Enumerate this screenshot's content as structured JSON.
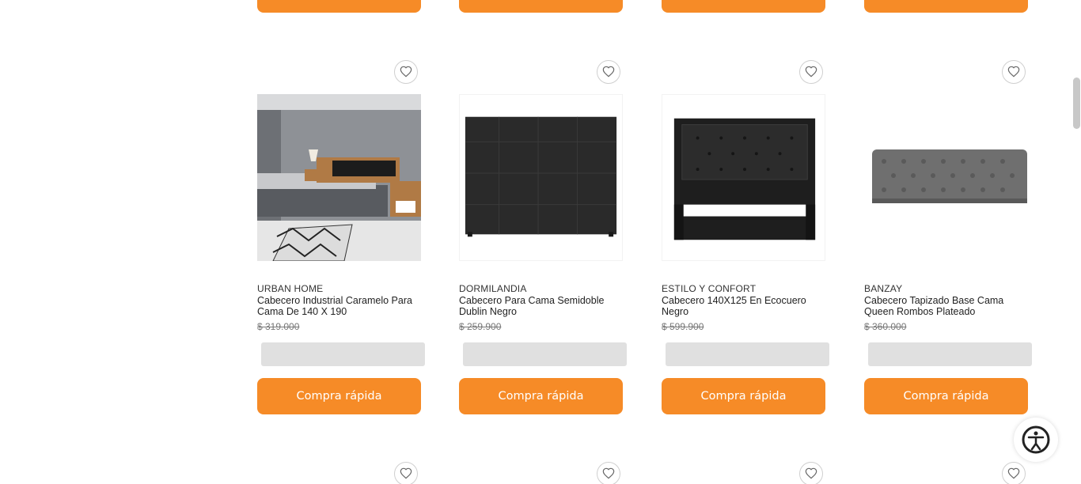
{
  "colors": {
    "accent": "#f68b27",
    "placeholder": "#e0e0e0",
    "price_strike": "#777777"
  },
  "products": [
    {
      "brand": "URBAN HOME",
      "name": "Cabecero Industrial Caramelo Para Cama De 140 X 190",
      "price": "$ 319.000",
      "button_label": "Compra rápida",
      "favorite_icon": "heart-icon"
    },
    {
      "brand": "DORMILANDIA",
      "name": "Cabecero Para Cama Semidoble Dublin Negro",
      "price": "$ 259.900",
      "button_label": "Compra rápida",
      "favorite_icon": "heart-icon"
    },
    {
      "brand": "ESTILO Y CONFORT",
      "name": "Cabecero 140X125 En Ecocuero Negro",
      "price": "$ 599.900",
      "button_label": "Compra rápida",
      "favorite_icon": "heart-icon"
    },
    {
      "brand": "BANZAY",
      "name": "Cabecero Tapizado Base Cama Queen Rombos Plateado",
      "price": "$ 360.000",
      "button_label": "Compra rápida",
      "favorite_icon": "heart-icon"
    }
  ],
  "accessibility_icon": "accessibility-icon"
}
